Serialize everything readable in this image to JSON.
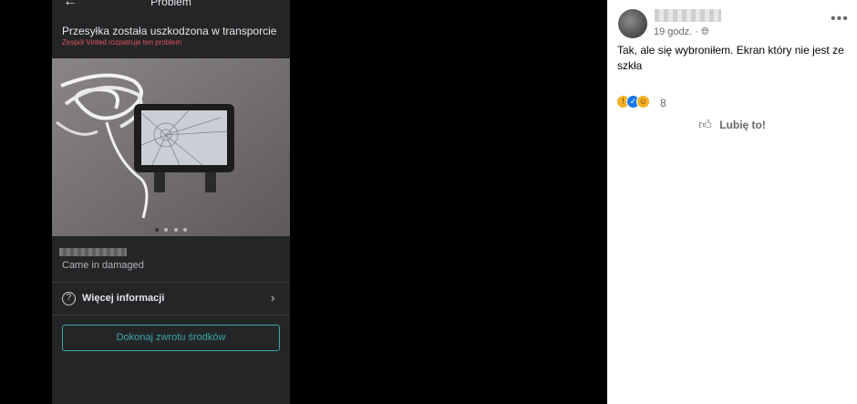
{
  "phone": {
    "title": "Problem",
    "back_icon": "arrow-left-icon",
    "problem_title": "Przesyłka została uszkodzona w transporcie",
    "problem_subtitle": "Zespół Vinted rozpatruje ten problem",
    "carousel_pages": 4,
    "carousel_active": 1,
    "item_description": "Came in damaged",
    "more_info_label": "Więcej informacji",
    "refund_button_label": "Dokonaj zwrotu środków",
    "accent_color": "#3aa6b0",
    "alert_color": "#e0545b"
  },
  "comment": {
    "time": "19 godz.",
    "separator": "·",
    "privacy_icon": "globe-icon",
    "text": "Tak, ale się wybroniłem. Ekran który nie jest ze szkła",
    "reaction_icons": [
      "wow-icon",
      "like-icon",
      "haha-icon"
    ],
    "reaction_count": "8",
    "like_label": "Lubię to!",
    "more_icon": "more-options-icon"
  }
}
